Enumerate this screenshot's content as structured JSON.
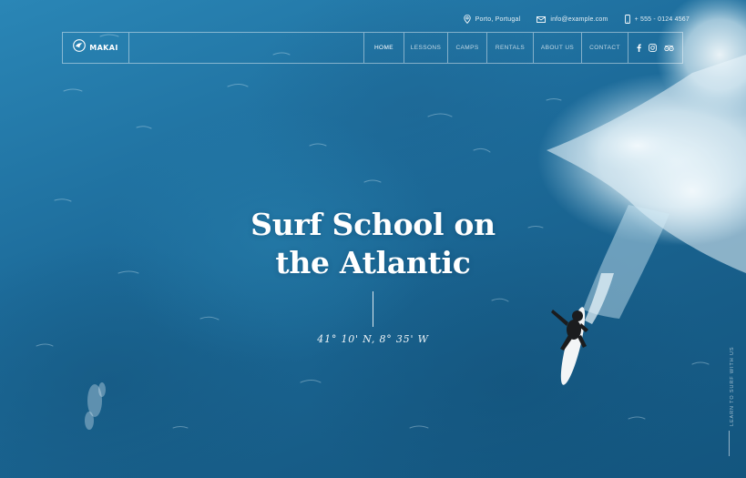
{
  "topbar": {
    "location": "Porto, Portugal",
    "email": "info@example.com",
    "phone": "+ 555 - 0124 4567",
    "location_icon": "map-pin-icon",
    "email_icon": "envelope-icon",
    "phone_icon": "mobile-phone-icon"
  },
  "nav": {
    "logo_text": "MAKAI",
    "items": [
      {
        "label": "HOME",
        "active": true
      },
      {
        "label": "LESSONS"
      },
      {
        "label": "CAMPS"
      },
      {
        "label": "RENTALS"
      },
      {
        "label": "ABOUT US"
      },
      {
        "label": "CONTACT"
      }
    ],
    "social": [
      "facebook-icon",
      "instagram-icon",
      "tripadvisor-icon"
    ]
  },
  "hero": {
    "title_line1": "Surf School on",
    "title_line2": "the Atlantic",
    "coordinates": "41° 10' N, 8° 35' W"
  },
  "side": {
    "text": "LEARN TO SURF WITH US"
  },
  "colors": {
    "ocean_dark": "#13557e",
    "ocean_mid": "#1d6c9b",
    "ocean_light": "#2a86b6",
    "foam": "#eaf4f9",
    "text": "#ffffff"
  }
}
